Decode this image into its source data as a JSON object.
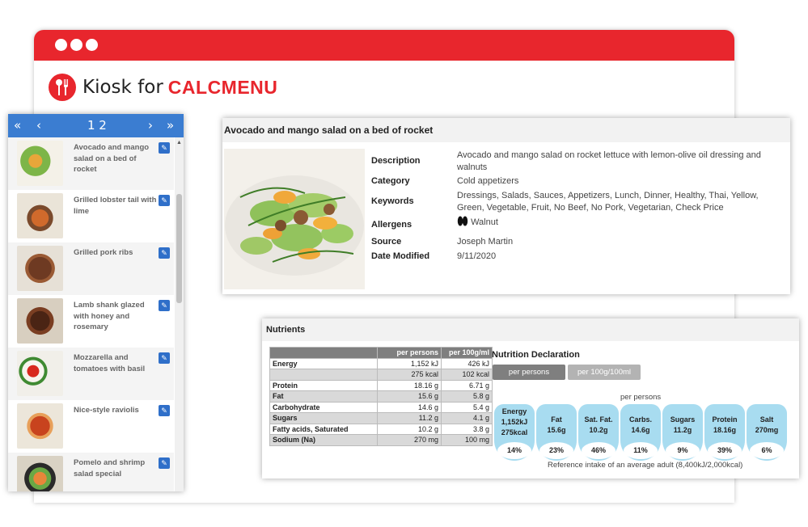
{
  "app": {
    "brand_prefix": "Kiosk for",
    "brand_name": "CALCMENU"
  },
  "pager": {
    "first": "«",
    "prev": "‹",
    "pages": "1 2",
    "next": "›",
    "last": "»"
  },
  "recipes": [
    {
      "name": "Avocado and mango salad on a bed of rocket"
    },
    {
      "name": "Grilled lobster tail with lime"
    },
    {
      "name": "Grilled pork ribs"
    },
    {
      "name": "Lamb shank glazed with honey and rosemary"
    },
    {
      "name": "Mozzarella and tomatoes with basil"
    },
    {
      "name": "Nice-style raviolis"
    },
    {
      "name": "Pomelo and shrimp salad special"
    }
  ],
  "detail": {
    "title": "Avocado and mango salad on a bed of rocket",
    "labels": {
      "description": "Description",
      "category": "Category",
      "keywords": "Keywords",
      "allergens": "Allergens",
      "source": "Source",
      "date_modified": "Date Modified"
    },
    "values": {
      "description": "Avocado and mango salad on rocket lettuce with lemon-olive oil dressing and walnuts",
      "category": "Cold appetizers",
      "keywords": "Dressings, Salads, Sauces, Appetizers, Lunch, Dinner, Healthy, Thai, Yellow, Green, Vegetable, Fruit, No Beef, No Pork, Vegetarian, Check Price",
      "allergens": "Walnut",
      "source": "Joseph Martin",
      "date_modified": "9/11/2020"
    }
  },
  "nutrients": {
    "title": "Nutrients",
    "columns": [
      "per persons",
      "per 100g/ml"
    ],
    "rows": [
      {
        "name": "Energy",
        "per_person": "1,152 kJ",
        "per_100": "426 kJ"
      },
      {
        "name": "",
        "per_person": "275 kcal",
        "per_100": "102 kcal"
      },
      {
        "name": "Protein",
        "per_person": "18.16 g",
        "per_100": "6.71 g"
      },
      {
        "name": "Fat",
        "per_person": "15.6 g",
        "per_100": "5.8 g"
      },
      {
        "name": "Carbohydrate",
        "per_person": "14.6 g",
        "per_100": "5.4 g"
      },
      {
        "name": "Sugars",
        "per_person": "11.2 g",
        "per_100": "4.1 g"
      },
      {
        "name": "Fatty acids, Saturated",
        "per_person": "10.2 g",
        "per_100": "3.8 g"
      },
      {
        "name": "Sodium (Na)",
        "per_person": "270 mg",
        "per_100": "100 mg"
      }
    ]
  },
  "declaration": {
    "title": "Nutrition Declaration",
    "tab_active": "per persons",
    "tab_inactive": "per 100g/100ml",
    "subtitle": "per persons",
    "items": [
      {
        "label": "Energy",
        "line2": "1,152kJ",
        "line3": "275kcal",
        "percent": "14%"
      },
      {
        "label": "Fat",
        "line2": "15.6g",
        "line3": "",
        "percent": "23%"
      },
      {
        "label": "Sat. Fat.",
        "line2": "10.2g",
        "line3": "",
        "percent": "46%"
      },
      {
        "label": "Carbs.",
        "line2": "14.6g",
        "line3": "",
        "percent": "11%"
      },
      {
        "label": "Sugars",
        "line2": "11.2g",
        "line3": "",
        "percent": "9%"
      },
      {
        "label": "Protein",
        "line2": "18.16g",
        "line3": "",
        "percent": "39%"
      },
      {
        "label": "Salt",
        "line2": "270mg",
        "line3": "",
        "percent": "6%"
      }
    ],
    "reference": "Reference intake of an average adult (8,400kJ/2,000kcal)"
  },
  "colors": {
    "brand_red": "#e8262d",
    "pager_blue": "#3b7dd1",
    "gda_blue": "#a8dcf0"
  }
}
